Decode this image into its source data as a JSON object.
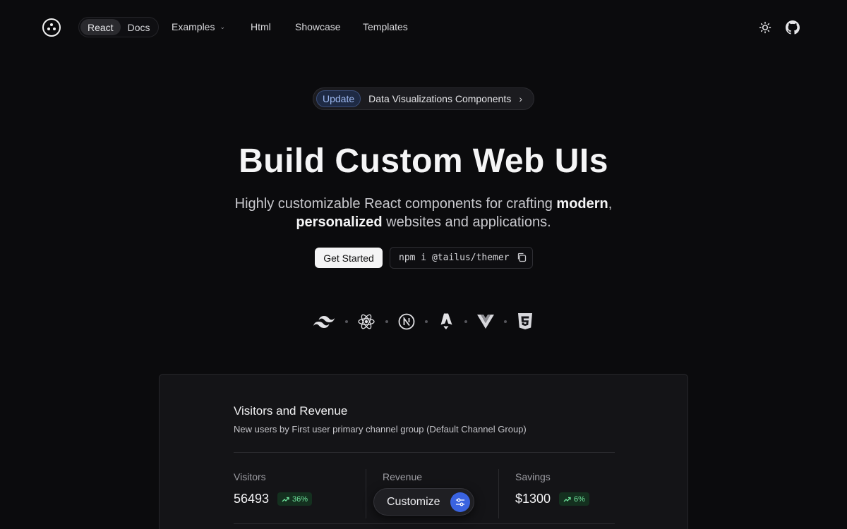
{
  "nav": {
    "segment": [
      {
        "label": "React",
        "active": true
      },
      {
        "label": "Docs",
        "active": false
      }
    ],
    "links": {
      "examples": "Examples",
      "html": "Html",
      "showcase": "Showcase",
      "templates": "Templates"
    },
    "icons": [
      "sun-icon",
      "github-icon"
    ]
  },
  "hero": {
    "badge": "Update",
    "announcement": "Data Visualizations Components",
    "title": "Build Custom Web UIs",
    "subtitle_part1": "Highly customizable React components for crafting ",
    "subtitle_bold1": "modern",
    "subtitle_part2": ", ",
    "subtitle_bold2": "personalized",
    "subtitle_part3": " websites and applications.",
    "cta": "Get Started",
    "command": "npm i @tailus/themer"
  },
  "tech_icons": [
    "tailwind-icon",
    "react-icon",
    "nextjs-icon",
    "astro-icon",
    "vue-icon",
    "html5-icon"
  ],
  "card": {
    "title": "Visitors and Revenue",
    "subtitle": "New users by First user primary channel group (Default Channel Group)",
    "stats": {
      "visitors": {
        "label": "Visitors",
        "value": "56493",
        "trend": "36%"
      },
      "revenue": {
        "label": "Revenue"
      },
      "savings": {
        "label": "Savings",
        "value": "$1300",
        "trend": "6%"
      }
    },
    "customize": "Customize"
  },
  "colors": {
    "background": "#0b0b0d",
    "accent_blue": "#3a63e0",
    "trend_green": "#6ee29b"
  }
}
